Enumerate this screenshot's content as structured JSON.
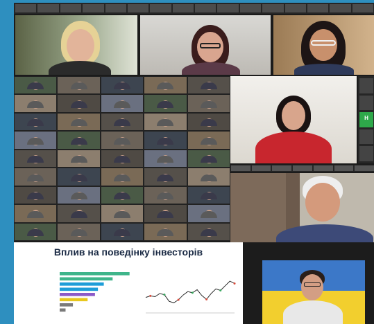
{
  "meeting": {
    "top_strip_names": [
      "",
      "",
      "",
      "",
      "",
      "",
      "",
      "",
      "",
      "",
      "",
      "",
      "",
      "",
      "",
      ""
    ],
    "gallery_left_names": [
      "",
      "",
      "",
      "",
      "",
      "",
      "",
      "",
      "",
      "",
      "",
      "",
      "",
      "",
      "",
      "",
      "",
      "",
      "",
      "",
      "",
      "",
      "",
      "",
      "",
      "",
      "",
      "",
      "",
      "",
      "",
      "",
      "",
      "",
      "",
      "",
      "",
      "",
      "",
      "",
      "",
      "",
      "",
      "",
      ""
    ],
    "green_tile_letter": "H"
  },
  "slide": {
    "title": "Вплив на поведінку інвесторів",
    "bar_chart_caption": "",
    "line_chart_caption": "",
    "bar_source_link": "",
    "line_source_link": ""
  },
  "chart_data": [
    {
      "type": "bar",
      "orientation": "horizontal",
      "categories": [
        "",
        "",
        "",
        "",
        "",
        "",
        "",
        ""
      ],
      "values": [
        95,
        72,
        60,
        52,
        48,
        38,
        18,
        8
      ],
      "colors": [
        "#3fb58a",
        "#3fb58a",
        "#1e9dd8",
        "#1e9dd8",
        "#8c5ac8",
        "#e8c81e",
        "#7a7a7a",
        "#7a7a7a"
      ]
    },
    {
      "type": "line",
      "series": [
        {
          "values": [
            40,
            44,
            42,
            50,
            47,
            30,
            26,
            34,
            46,
            55,
            52,
            60,
            45,
            35,
            50,
            62,
            58,
            70,
            82,
            76
          ]
        }
      ]
    }
  ],
  "colors": {
    "page_bg": "#2e8fbf",
    "collage_bg": "#1b1b1b",
    "slide_title": "#1a2a44",
    "green_tile": "#2ea84a"
  }
}
